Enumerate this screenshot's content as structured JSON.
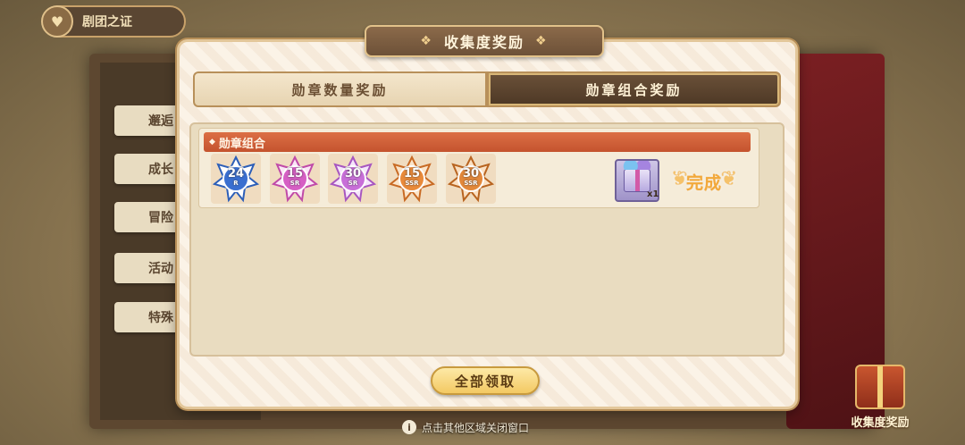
{
  "background": {
    "top_badge_label": "剧团之证",
    "sidebar_items": [
      {
        "label": "邂逅"
      },
      {
        "label": "成长"
      },
      {
        "label": "冒险"
      },
      {
        "label": "活动"
      },
      {
        "label": "特殊"
      }
    ],
    "corner_button_label": "收集度奖励"
  },
  "modal": {
    "title": "收集度奖励",
    "tabs": [
      {
        "label": "勋章数量奖励",
        "active": false
      },
      {
        "label": "勋章组合奖励",
        "active": true
      }
    ],
    "combo": {
      "header": "勋章组合",
      "badges": [
        {
          "number": "24",
          "rank": "R",
          "color": "#3a6fd0"
        },
        {
          "number": "15",
          "rank": "SR",
          "color": "#d65fc4"
        },
        {
          "number": "30",
          "rank": "SR",
          "color": "#c86fd8"
        },
        {
          "number": "15",
          "rank": "SSR",
          "color": "#e98a3a"
        },
        {
          "number": "30",
          "rank": "SSR",
          "color": "#e3883a"
        }
      ],
      "reward": {
        "icon": "gift-box-icon",
        "quantity": "x1"
      },
      "status": "完成"
    },
    "claim_all_label": "全部领取"
  },
  "hint": {
    "text": "点击其他区域关闭窗口",
    "icon": "info-icon"
  }
}
